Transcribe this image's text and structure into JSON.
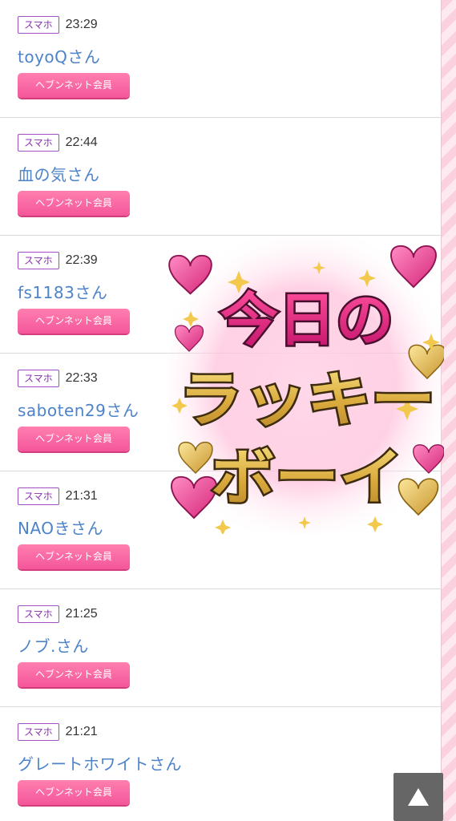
{
  "entries": [
    {
      "device": "スマホ",
      "time": "23:29",
      "name": "toyoQさん",
      "member": "ヘブンネット会員"
    },
    {
      "device": "スマホ",
      "time": "22:44",
      "name": "血の気さん",
      "member": "ヘブンネット会員"
    },
    {
      "device": "スマホ",
      "time": "22:39",
      "name": "fs1183さん",
      "member": "ヘブンネット会員"
    },
    {
      "device": "スマホ",
      "time": "22:33",
      "name": "saboten29さん",
      "member": "ヘブンネット会員"
    },
    {
      "device": "スマホ",
      "time": "21:31",
      "name": "NAOきさん",
      "member": "ヘブンネット会員"
    },
    {
      "device": "スマホ",
      "time": "21:25",
      "name": "ノブ.さん",
      "member": "ヘブンネット会員"
    },
    {
      "device": "スマホ",
      "time": "21:21",
      "name": "グレートホワイトさん",
      "member": "ヘブンネット会員"
    }
  ],
  "sticker": {
    "line1": "今日の",
    "line2": "ラッキー",
    "line3": "ボーイ"
  },
  "scroll_top": {
    "icon": "triangle-up-icon"
  },
  "colors": {
    "name_link": "#4d83c9",
    "member_badge": "#f4569a",
    "device_badge_border": "#a34fc4"
  }
}
